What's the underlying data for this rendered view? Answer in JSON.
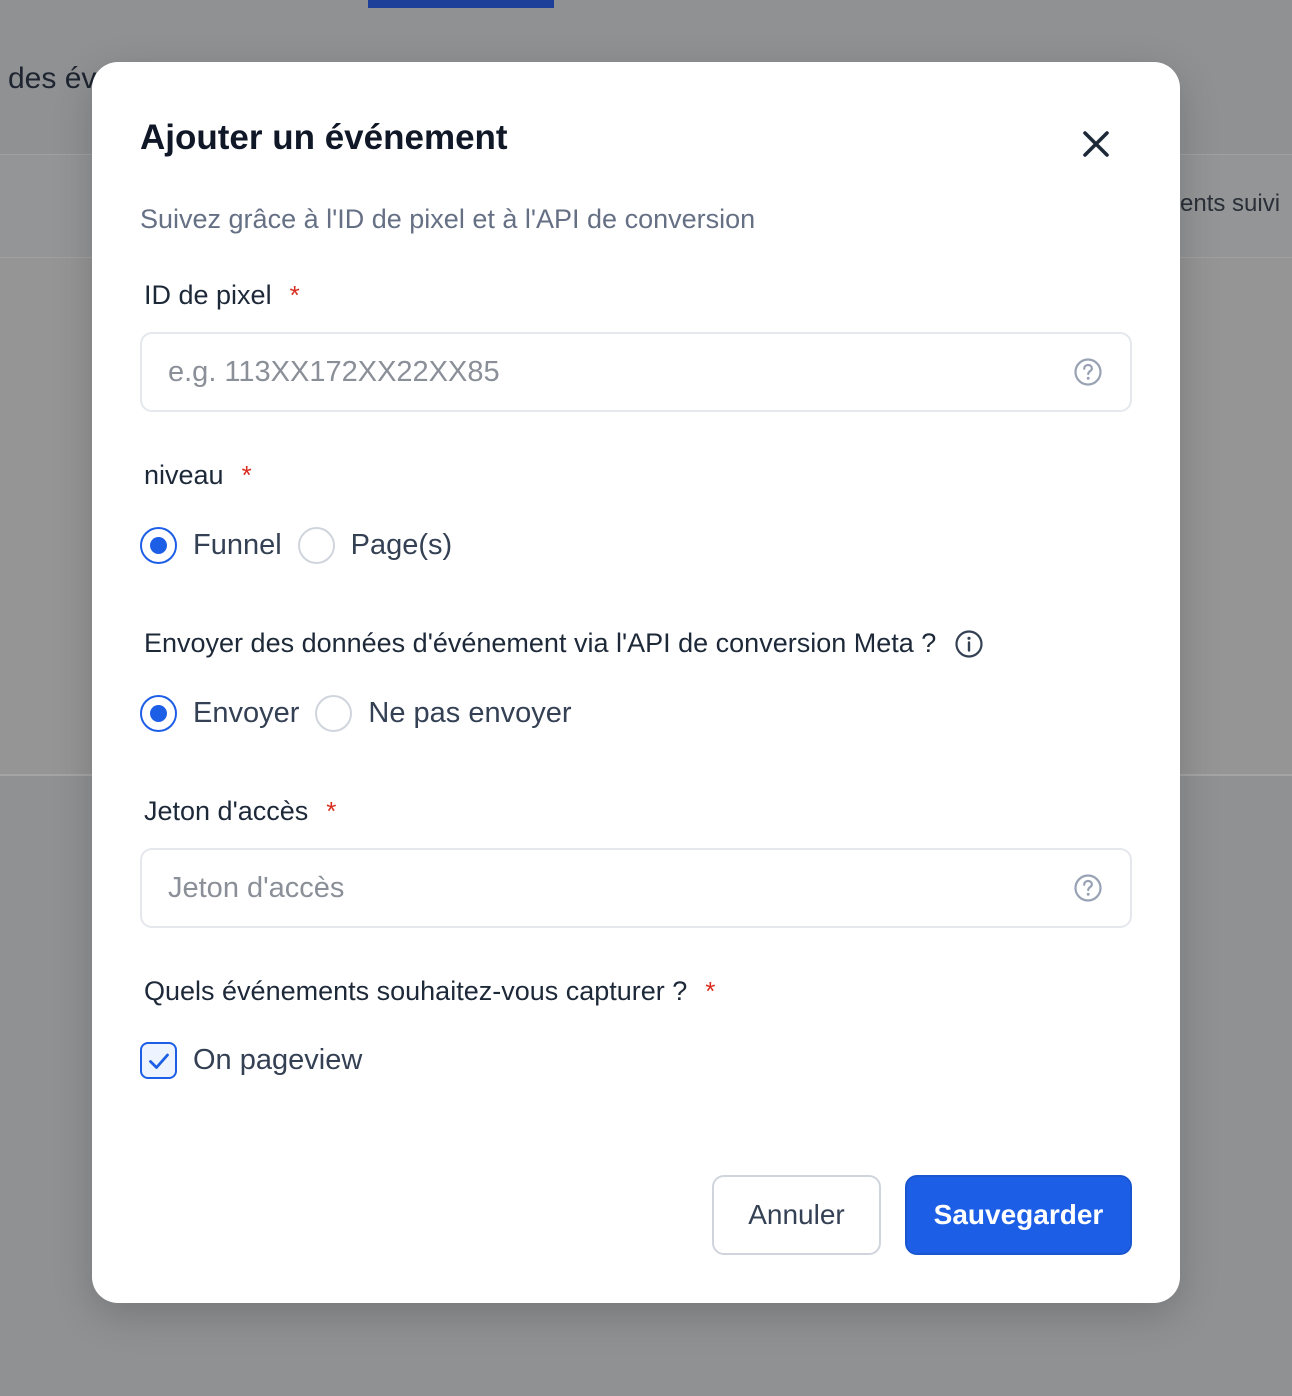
{
  "background": {
    "heading_fragment": "des év",
    "tracked_fragment": "ents suivi"
  },
  "modal": {
    "title": "Ajouter un événement",
    "subtitle": "Suivez grâce à l'ID de pixel et à l'API de conversion",
    "close_icon": "close-icon",
    "required_marker": "*",
    "pixel_id": {
      "label": "ID de pixel",
      "value": "",
      "placeholder": "e.g. 113XX172XX22XX85",
      "help_icon": "question-circle-icon"
    },
    "level": {
      "label": "niveau",
      "options": [
        {
          "label": "Funnel",
          "checked": true
        },
        {
          "label": "Page(s)",
          "checked": false
        }
      ]
    },
    "send_data": {
      "label": "Envoyer des données d'événement via l'API de conversion Meta ?",
      "info_icon": "info-circle-icon",
      "options": [
        {
          "label": "Envoyer",
          "checked": true
        },
        {
          "label": "Ne pas envoyer",
          "checked": false
        }
      ]
    },
    "access_token": {
      "label": "Jeton d'accès",
      "value": "",
      "placeholder": "Jeton d'accès",
      "help_icon": "question-circle-icon"
    },
    "events": {
      "label": "Quels événements souhaitez-vous capturer ?",
      "options": [
        {
          "label": "On pageview",
          "checked": true
        }
      ]
    },
    "buttons": {
      "cancel": "Annuler",
      "save": "Sauvegarder"
    }
  },
  "colors": {
    "accent": "#1c5fe6",
    "required": "#d92d20",
    "overlay": "#8f9193",
    "tab_indicator": "#1d3f99"
  }
}
